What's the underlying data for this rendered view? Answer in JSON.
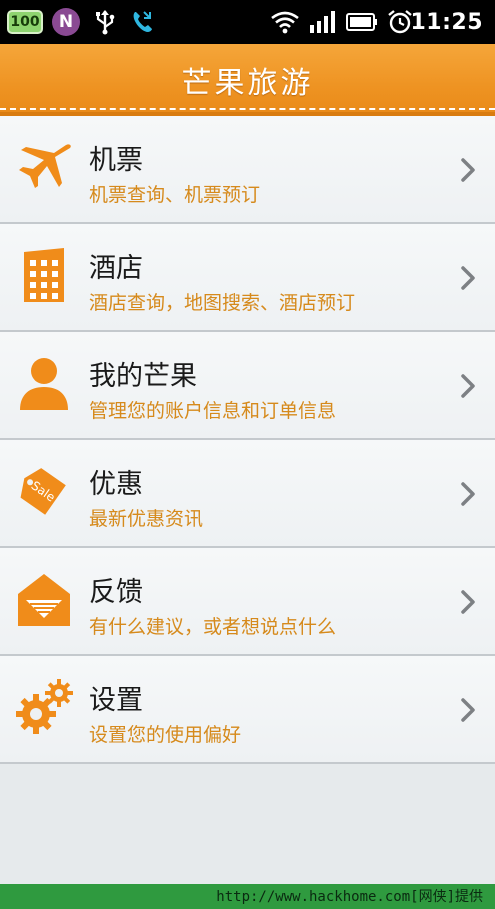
{
  "status_bar": {
    "battery_badge": "100",
    "n_badge": "N",
    "time": "11:25"
  },
  "header": {
    "title": "芒果旅游"
  },
  "menu": [
    {
      "title": "机票",
      "subtitle": "机票查询、机票预订",
      "icon": "airplane-icon"
    },
    {
      "title": "酒店",
      "subtitle": "酒店查询，地图搜索、酒店预订",
      "icon": "hotel-building-icon"
    },
    {
      "title": "我的芒果",
      "subtitle": "管理您的账户信息和订单信息",
      "icon": "person-icon"
    },
    {
      "title": "优惠",
      "subtitle": "最新优惠资讯",
      "icon": "sale-tag-icon",
      "tag_text": "Sale"
    },
    {
      "title": "反馈",
      "subtitle": "有什么建议，或者想说点什么",
      "icon": "envelope-icon"
    },
    {
      "title": "设置",
      "subtitle": "设置您的使用偏好",
      "icon": "gears-icon"
    }
  ],
  "watermark": "http://www.hackhome.com[网侠]提供",
  "colors": {
    "accent": "#f08c1a",
    "subtitle": "#d68a1c",
    "header_top": "#f5a63a",
    "footer_bar": "#2f9a3f"
  }
}
